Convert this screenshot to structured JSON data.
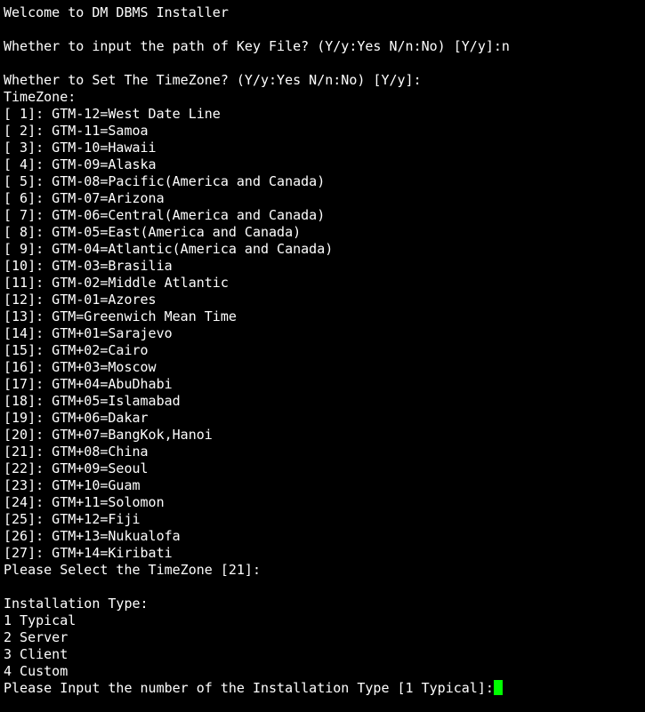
{
  "colors": {
    "background": "#000000",
    "text": "#ffffff",
    "cursor": "#00ff00"
  },
  "terminal": {
    "welcome": "Welcome to DM DBMS Installer",
    "key_file_prompt": "Whether to input the path of Key File? (Y/y:Yes N/n:No) [Y/y]:n",
    "timezone_prompt": "Whether to Set The TimeZone? (Y/y:Yes N/n:No) [Y/y]:",
    "timezone_header": "TimeZone:",
    "timezones": [
      "[ 1]: GTM-12=West Date Line",
      "[ 2]: GTM-11=Samoa",
      "[ 3]: GTM-10=Hawaii",
      "[ 4]: GTM-09=Alaska",
      "[ 5]: GTM-08=Pacific(America and Canada)",
      "[ 6]: GTM-07=Arizona",
      "[ 7]: GTM-06=Central(America and Canada)",
      "[ 8]: GTM-05=East(America and Canada)",
      "[ 9]: GTM-04=Atlantic(America and Canada)",
      "[10]: GTM-03=Brasilia",
      "[11]: GTM-02=Middle Atlantic",
      "[12]: GTM-01=Azores",
      "[13]: GTM=Greenwich Mean Time",
      "[14]: GTM+01=Sarajevo",
      "[15]: GTM+02=Cairo",
      "[16]: GTM+03=Moscow",
      "[17]: GTM+04=AbuDhabi",
      "[18]: GTM+05=Islamabad",
      "[19]: GTM+06=Dakar",
      "[20]: GTM+07=BangKok,Hanoi",
      "[21]: GTM+08=China",
      "[22]: GTM+09=Seoul",
      "[23]: GTM+10=Guam",
      "[24]: GTM+11=Solomon",
      "[25]: GTM+12=Fiji",
      "[26]: GTM+13=Nukualofa",
      "[27]: GTM+14=Kiribati"
    ],
    "select_timezone_prompt": "Please Select the TimeZone [21]:",
    "installation_type_header": "Installation Type:",
    "installation_types": [
      "1 Typical",
      "2 Server",
      "3 Client",
      "4 Custom"
    ],
    "installation_type_prompt": "Please Input the number of the Installation Type [1 Typical]:"
  }
}
